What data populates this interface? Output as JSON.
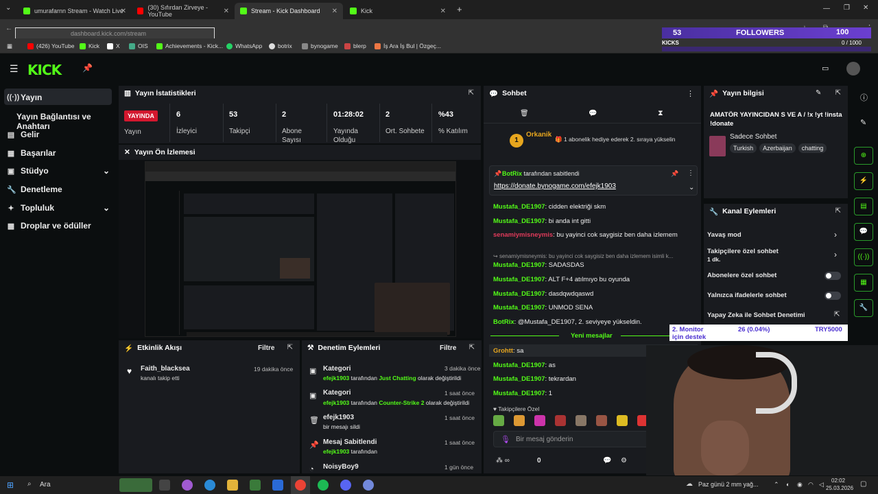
{
  "browser": {
    "tabs": [
      {
        "label": "umurafarnn Stream - Watch Live",
        "active": false
      },
      {
        "label": "(30) Sıfırdan Zirveye - YouTube",
        "active": false
      },
      {
        "label": "Stream - Kick Dashboard",
        "active": true
      },
      {
        "label": "Kick",
        "active": false
      }
    ],
    "url": "dashboard.kick.com/stream",
    "bookmarks": [
      "(426) YouTube",
      "Kick",
      "X",
      "OIS",
      "Achievements - Kick...",
      "WhatsApp",
      "botrix",
      "bynogame",
      "blerp",
      "İş Ara İş Bul | Özgeç..."
    ]
  },
  "overlay": {
    "followers_count": "53",
    "followers_label": "FOLLOWERS",
    "kicks_label": "KICKS",
    "progress": "0 / 1000",
    "score": "100"
  },
  "header": {
    "logo": "KICK"
  },
  "sidebar": {
    "items": [
      {
        "label": "Yayın",
        "icon": "broadcast-icon"
      },
      {
        "label": "Yayın Bağlantısı ve Anahtarı",
        "icon": ""
      },
      {
        "label": "Gelir",
        "icon": "dollar-icon"
      },
      {
        "label": "Başarılar",
        "icon": "trophy-icon"
      },
      {
        "label": "Stüdyo",
        "icon": "studio-icon"
      },
      {
        "label": "Denetleme",
        "icon": "wrench-icon"
      },
      {
        "label": "Topluluk",
        "icon": "community-icon"
      },
      {
        "label": "Droplar ve ödüller",
        "icon": "gift-icon"
      }
    ]
  },
  "stats": {
    "title": "Yayın İstatistikleri",
    "live_badge": "YAYINDA",
    "status_label": "Yayın",
    "items": [
      {
        "value": "6",
        "label": "İzleyici"
      },
      {
        "value": "53",
        "label": "Takipçi"
      },
      {
        "value": "2",
        "label": "Abone Sayısı"
      },
      {
        "value": "01:28:02",
        "label": "Yayında Olduğu"
      },
      {
        "value": "2",
        "label": "Ort. Sohbete"
      },
      {
        "value": "%43",
        "label": "% Katılım"
      }
    ]
  },
  "preview": {
    "title": "Yayın Ön İzlemesi"
  },
  "activity": {
    "title": "Etkinlik Akışı",
    "filter": "Filtre",
    "events": [
      {
        "user": "Faith_blacksea",
        "text": "kanalı takip etti",
        "time": "19 dakika önce"
      }
    ]
  },
  "moderation": {
    "title": "Denetim Eylemleri",
    "filter": "Filtre",
    "items": [
      {
        "title": "Kategori",
        "by": "efejk1903",
        "mid": "tarafından",
        "highlight": "Just Chatting",
        "tail": "olarak değiştirildi",
        "time": "3 dakika önce"
      },
      {
        "title": "Kategori",
        "by": "efejk1903",
        "mid": "tarafından",
        "highlight": "Counter-Strike 2",
        "tail": "olarak değiştirildi",
        "time": "1 saat önce"
      },
      {
        "title": "efejk1903",
        "by": "",
        "mid": "bir mesajı sildi",
        "highlight": "",
        "tail": "",
        "time": "1 saat önce"
      },
      {
        "title": "Mesaj Sabitlendi",
        "by": "efejk1903",
        "mid": "tarafından",
        "highlight": "",
        "tail": "",
        "time": "1 saat önce"
      },
      {
        "title": "NoisyBoy9",
        "by": "",
        "mid": "",
        "highlight": "",
        "tail": "",
        "time": "1 gün önce"
      }
    ]
  },
  "chat": {
    "title": "Sohbet",
    "gift_user": "Orkanik",
    "gift_count": "1",
    "gift_text": "1 abonelik hediye ederek 2. sıraya yükselin",
    "pinned_by": "BotRix",
    "pinned_label": "tarafından sabitlendi",
    "pinned_link": "https://donate.bynogame.com/efejk1903",
    "messages": [
      {
        "user": "Mustafa_DE1907",
        "text": "cidden elektriği skm"
      },
      {
        "user": "Mustafa_DE1907",
        "text": "bi anda int gitti"
      },
      {
        "user": "senamiymisneymis",
        "text": "bu yayinci cok saygisiz ben daha izlemem"
      },
      {
        "reply": "senamiymisneymis: bu yayinci cok saygisiz ben daha izlemem isimli k..."
      },
      {
        "user": "Mustafa_DE1907",
        "text": "SADASDAS"
      },
      {
        "user": "Mustafa_DE1907",
        "text": "ALT F+4 atılmıyo bu oyunda"
      },
      {
        "user": "Mustafa_DE1907",
        "text": "dasdqwdqaswd"
      },
      {
        "user": "Mustafa_DE1907",
        "text": "UNMOD SENA"
      },
      {
        "user": "BotRix",
        "text": "@Mustafa_DE1907, 2. seviyeye yükseldin."
      }
    ],
    "new_messages": "Yeni mesajlar",
    "messages2": [
      {
        "user": "Grohtt",
        "text": "sa"
      },
      {
        "user": "Mustafa_DE1907",
        "text": "as"
      },
      {
        "user": "Mustafa_DE1907",
        "text": "tekrardan"
      },
      {
        "user": "Mustafa_DE1907",
        "text": "1"
      }
    ],
    "followers_only": "Takipçilere Özel",
    "input_placeholder": "Bir mesaj gönderin",
    "infinity_count": "0"
  },
  "stream_info": {
    "title": "Yayın bilgisi",
    "stream_title": "AMATÖR YAYINCIDAN S VE A / !x !yt !insta !donate",
    "category": "Sadece Sohbet",
    "tags": [
      "Turkish",
      "Azerbaijan",
      "chatting"
    ]
  },
  "channel_actions": {
    "title": "Kanal Eylemleri",
    "items": [
      {
        "label": "Yavaş mod",
        "sub": "",
        "type": "chevron"
      },
      {
        "label": "Takipçilere özel sohbet",
        "sub": "1 dk.",
        "type": "chevron"
      },
      {
        "label": "Abonelere özel sohbet",
        "sub": "",
        "type": "toggle"
      },
      {
        "label": "Yalnızca ifadelerle sohbet",
        "sub": "",
        "type": "toggle"
      },
      {
        "label": "Yapay Zeka ile Sohbet Denetimi",
        "sub": "",
        "type": "link"
      }
    ]
  },
  "monitor_overlay": {
    "label": "2. Monitor için destek",
    "amount": "26 (0.04%)",
    "goal": "TRY5000"
  },
  "taskbar": {
    "search": "Ara",
    "weather": "Paz günü 2 mm yağ...",
    "time": "02:02",
    "date": "25.03.2026"
  },
  "colors": {
    "accent": "#53fc18",
    "live": "#d3172e",
    "panel": "#191b1f"
  }
}
